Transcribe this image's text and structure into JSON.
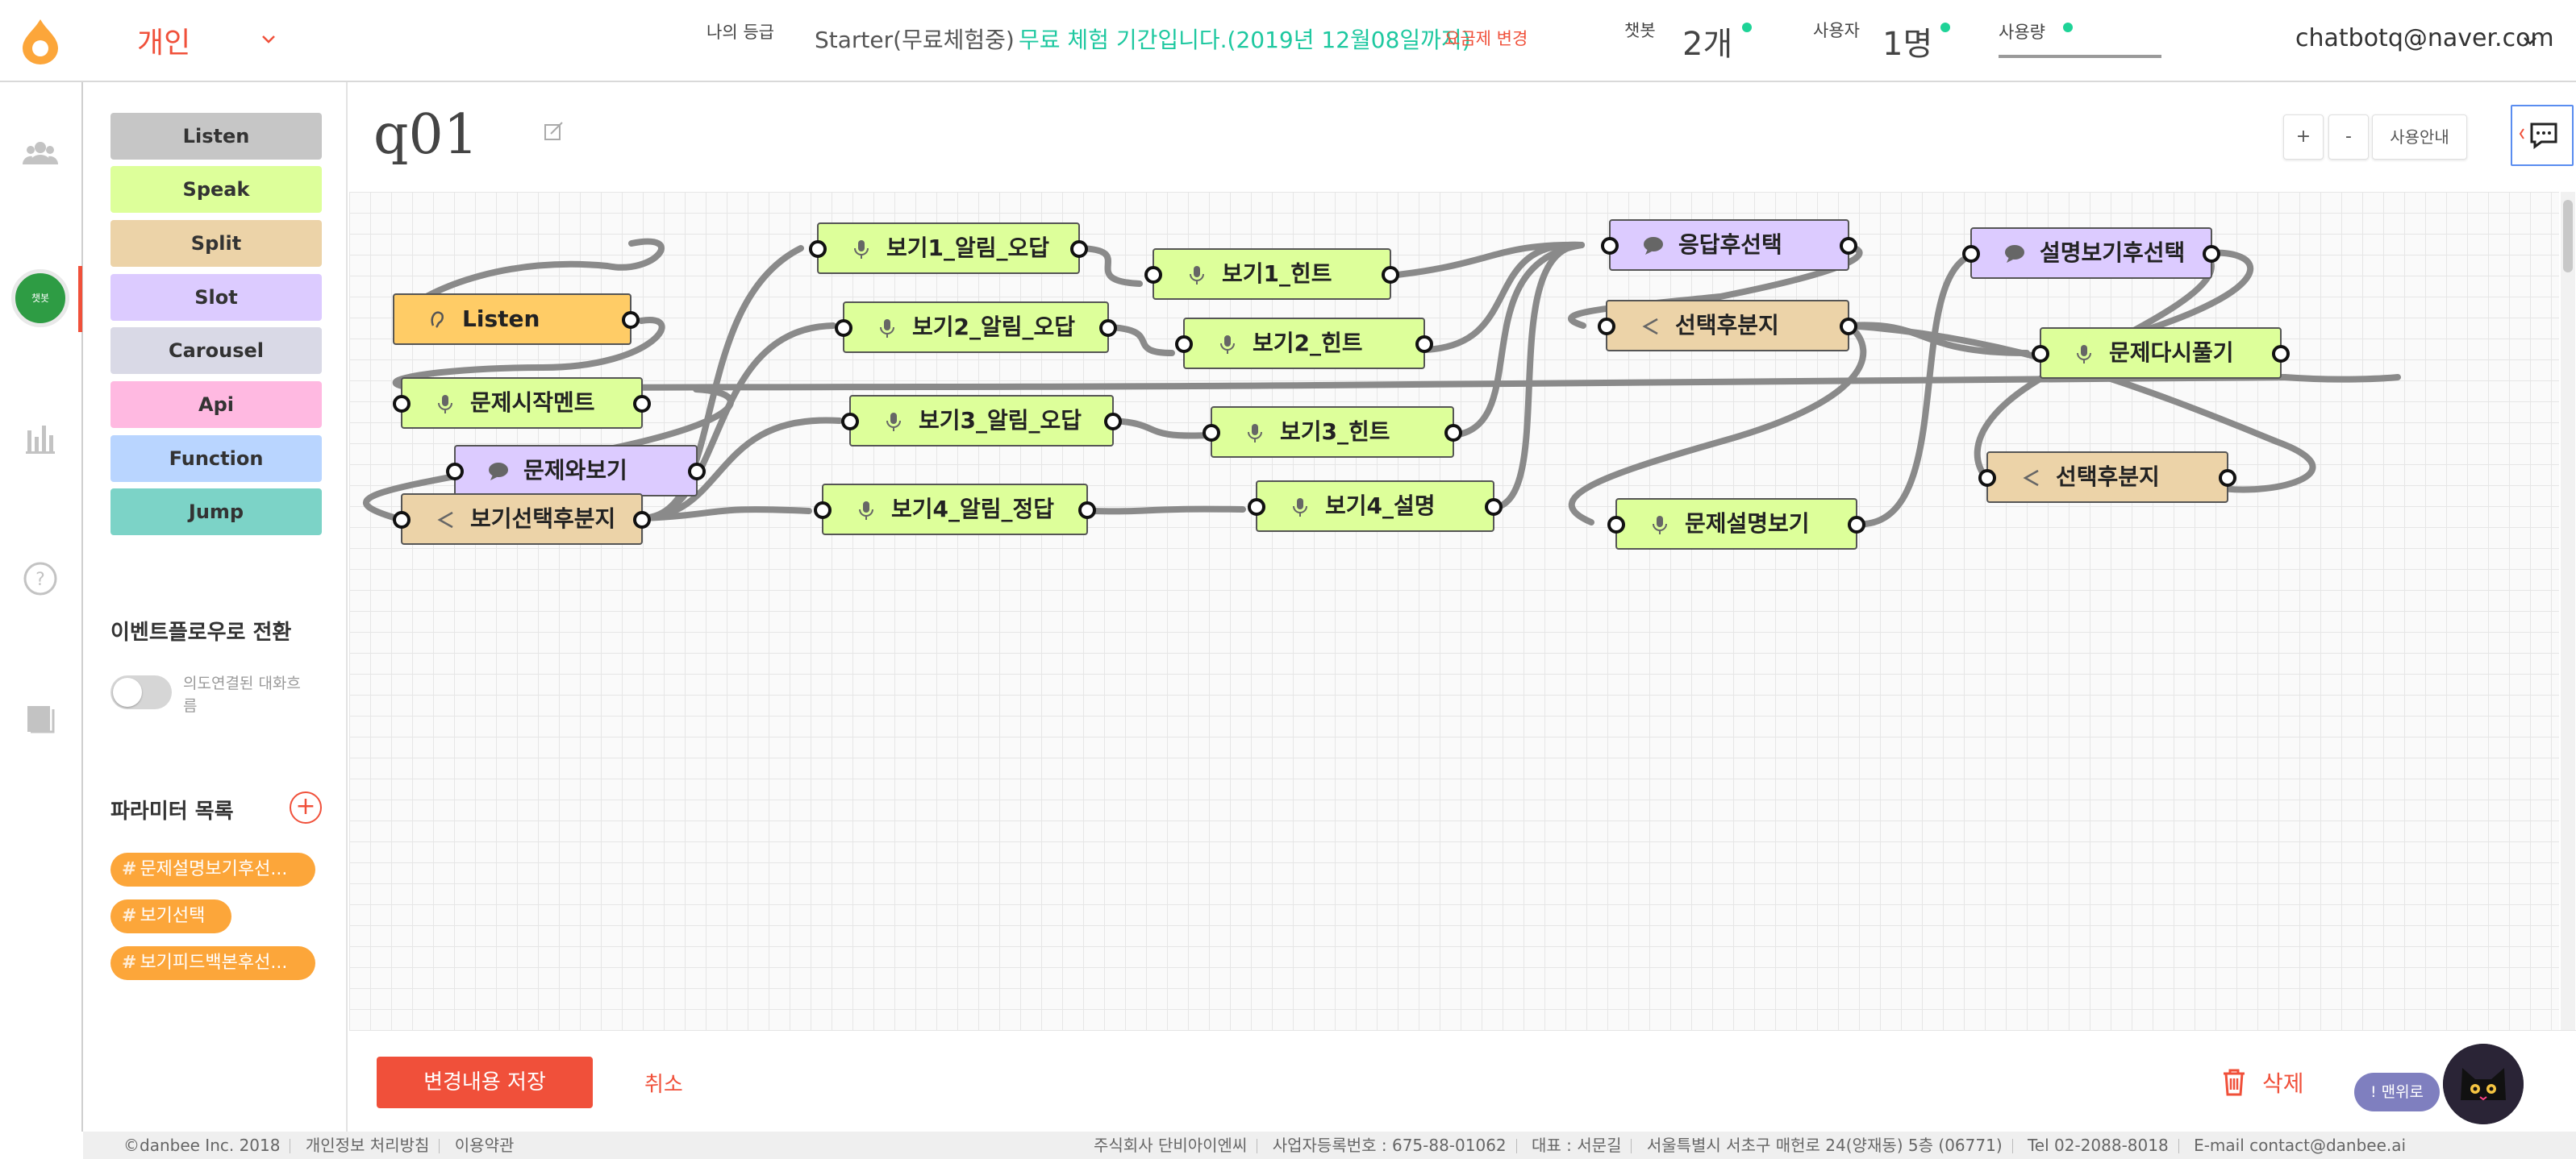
{
  "header": {
    "workspace": "개인",
    "grade_label": "나의 등급",
    "grade_value": "Starter(무료체험중)",
    "trial_notice": "무료 체험 기간입니다.(2019년 12월08일까지)",
    "plan_change": "요금제 변경",
    "chatbot_label": "챗봇",
    "chatbot_count": "2개",
    "users_label": "사용자",
    "users_count": "1명",
    "usage_label": "사용량",
    "email": "chatbotq@naver.com"
  },
  "rail": {
    "items": [
      "users-icon",
      "chatbot-avatar",
      "chart-icon",
      "help-icon",
      "book-icon"
    ],
    "avatar_text": "챗봇"
  },
  "palette": {
    "buttons": [
      {
        "label": "Listen",
        "color": "#c6c6c6"
      },
      {
        "label": "Speak",
        "color": "#ddff9a"
      },
      {
        "label": "Split",
        "color": "#ecd3a8"
      },
      {
        "label": "Slot",
        "color": "#dccbff"
      },
      {
        "label": "Carousel",
        "color": "#d9d9e6"
      },
      {
        "label": "Api",
        "color": "#ffb9e1"
      },
      {
        "label": "Function",
        "color": "#b9d5ff"
      },
      {
        "label": "Jump",
        "color": "#7cd3c7"
      }
    ],
    "event_flow_title": "이벤트플로우로 전환",
    "toggle_label": "의도연결된 대화흐름",
    "params_title": "파라미터 목록",
    "params": [
      "문제설명보기후선...",
      "보기선택",
      "보기피드백본후선..."
    ]
  },
  "canvas": {
    "title": "q01",
    "zoom_in": "+",
    "zoom_out": "-",
    "guide": "사용안내",
    "nodes": [
      {
        "id": "listen",
        "label": "Listen",
        "type": "listen"
      },
      {
        "id": "start",
        "label": "문제시작멘트",
        "type": "speak"
      },
      {
        "id": "q",
        "label": "문제와보기",
        "type": "slot"
      },
      {
        "id": "split1",
        "label": "보기선택후분지",
        "type": "split"
      },
      {
        "id": "b1a",
        "label": "보기1_알림_오답",
        "type": "speak"
      },
      {
        "id": "b2a",
        "label": "보기2_알림_오답",
        "type": "speak"
      },
      {
        "id": "b3a",
        "label": "보기3_알림_오답",
        "type": "speak"
      },
      {
        "id": "b4a",
        "label": "보기4_알림_정답",
        "type": "speak"
      },
      {
        "id": "b1h",
        "label": "보기1_힌트",
        "type": "speak"
      },
      {
        "id": "b2h",
        "label": "보기2_힌트",
        "type": "speak"
      },
      {
        "id": "b3h",
        "label": "보기3_힌트",
        "type": "speak"
      },
      {
        "id": "b4e",
        "label": "보기4_설명",
        "type": "speak"
      },
      {
        "id": "resp",
        "label": "응답후선택",
        "type": "slot"
      },
      {
        "id": "split2",
        "label": "선택후분지",
        "type": "split"
      },
      {
        "id": "explain",
        "label": "문제설명보기",
        "type": "speak"
      },
      {
        "id": "explsel",
        "label": "설명보기후선택",
        "type": "slot"
      },
      {
        "id": "retry",
        "label": "문제다시풀기",
        "type": "speak"
      },
      {
        "id": "split3",
        "label": "선택후분지",
        "type": "split"
      }
    ],
    "node_colors": {
      "listen": "#ffcc66",
      "speak": "#ddff9a",
      "slot": "#dccbff",
      "split": "#ecd3a8"
    }
  },
  "actions": {
    "save": "변경내용 저장",
    "cancel": "취소",
    "delete": "삭제",
    "to_top": "! 맨위로"
  },
  "footer": {
    "copyright": "©danbee Inc. 2018",
    "privacy": "개인정보 처리방침",
    "terms": "이용약관",
    "company": "주식회사 단비아이엔씨",
    "biz_no": "사업자등록번호 : 675-88-01062",
    "ceo": "대표 : 서문길",
    "address": "서울특별시 서초구 매헌로 24(양재동) 5층 (06771)",
    "tel": "Tel 02-2088-8018",
    "email": "E-mail contact@danbee.ai"
  }
}
